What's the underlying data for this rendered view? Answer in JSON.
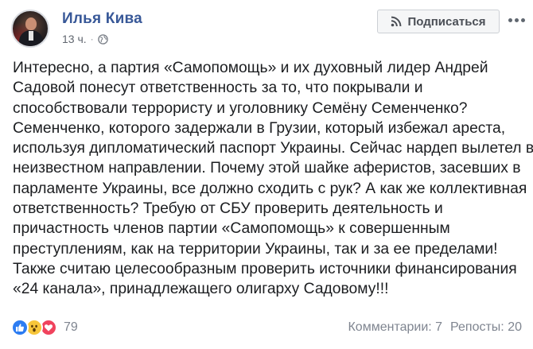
{
  "post": {
    "author": "Илья Кива",
    "time": "13 ч.",
    "separator": "·",
    "subscribe_label": "Подписаться",
    "text_lines": [
      "Интересно, а партия «Самопомощь» и их духовный лидер Андрей",
      "Садовой понесут ответственность за то, что покрывали и",
      "способствовали террористу и уголовнику Семёну Семенченко?",
      "Семенченко, которого задержали в Грузии, который избежал ареста,",
      "используя дипломатический паспорт Украины. Сейчас нардеп вылетел в",
      "неизвестном направлении. Почему этой шайке аферистов, засевших в",
      "парламенте Украины, все должно сходить с рук? А как же коллективная",
      "ответственность? Требую от СБУ проверить деятельность и",
      "причастность членов партии «Самопомощь» к совершенным",
      "преступлениям, как на территории Украины, так и за ее пределами!",
      "Также считаю целесообразным проверить источники финансирования",
      "«24 канала», принадлежащего олигарху Садовому!!!"
    ],
    "reactions": {
      "types": [
        "like-icon",
        "wow-icon",
        "love-icon"
      ],
      "count": "79"
    },
    "comments": "Комментарии: 7",
    "shares": "Репосты: 20"
  },
  "colors": {
    "author": "#385898",
    "text": "#1c1e21",
    "meta": "#616770",
    "like": "#2c7cf2",
    "wow": "#f7c63a",
    "love": "#f0435d"
  }
}
